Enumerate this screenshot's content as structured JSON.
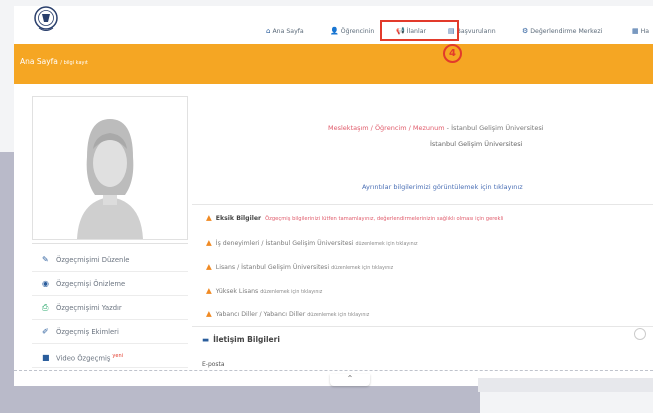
{
  "nav": {
    "items": [
      {
        "icon": "home-icon",
        "glyph": "⌂",
        "label": "Ana Sayfa"
      },
      {
        "icon": "user-icon",
        "glyph": "👤",
        "label": "Öğrencinin"
      },
      {
        "icon": "bullhorn-icon",
        "glyph": "📢",
        "label": "İlanlar"
      },
      {
        "icon": "list-icon",
        "glyph": "▤",
        "label": "Başvuruların"
      },
      {
        "icon": "gear-icon",
        "glyph": "⚙",
        "label": "Değerlendirme Merkezi"
      },
      {
        "icon": "chart-icon",
        "glyph": "▦",
        "label": "Ha"
      }
    ]
  },
  "marker": {
    "label": "4"
  },
  "breadcrumb": {
    "title": "Ana Sayfa",
    "sub": "/ bilgi kayıt"
  },
  "university": {
    "line1_prefix": "Meslektaşım / Öğrencim / Mezunum",
    "line1_suffix": "- İstanbul Gelişim Üniversitesi",
    "line2": "İstanbul Gelişim Üniversitesi"
  },
  "info_link": "Ayrıntılar bilgilerimizi görüntülemek için tıklayınız",
  "warnings": [
    {
      "head": "Eksik Bilgiler",
      "text": "Özgeçmiş bilgilerinizi lütfen tamamlayınız, değerlendirmelerinizin sağlıklı olması için gerekli",
      "red": true
    },
    {
      "head": "",
      "text": "İş deneyimleri / İstanbul Gelişim Üniversitesi",
      "small": "düzenlemek için tıklayınız",
      "red": false
    },
    {
      "head": "",
      "text": "Lisans / İstanbul Gelişim Üniversitesi",
      "small": "düzenlemek için tıklayınız",
      "red": false
    },
    {
      "head": "",
      "text": "Yüksek Lisans",
      "small": "düzenlemek için tıklayınız",
      "red": false
    },
    {
      "head": "",
      "text": "Yabancı Diller / Yabancı Diller",
      "small": "düzenlemek için tıklayınız",
      "red": false
    }
  ],
  "menu": [
    {
      "icon": "edit-icon",
      "glyph": "✎",
      "label": "Özgeçmişimi Düzenle",
      "color": "#2a5d9c",
      "new": ""
    },
    {
      "icon": "eye-icon",
      "glyph": "◉",
      "label": "Özgeçmişi Önizleme",
      "color": "#2a5d9c",
      "new": ""
    },
    {
      "icon": "print-icon",
      "glyph": "⎙",
      "label": "Özgeçmişimi Yazdır",
      "color": "#2aa86c",
      "new": ""
    },
    {
      "icon": "pencil-icon",
      "glyph": "✐",
      "label": "Özgeçmiş Ekimleri",
      "color": "#2a5d9c",
      "new": ""
    },
    {
      "icon": "video-icon",
      "glyph": "■",
      "label": "Video Özgeçmiş",
      "color": "#2a5d9c",
      "new": "yeni"
    }
  ],
  "contact": {
    "title": "İletişim Bilgileri",
    "email_label": "E-posta"
  },
  "colors": {
    "accent": "#f5a623",
    "highlight": "#e23a2b",
    "brand": "#2a5d9c"
  }
}
